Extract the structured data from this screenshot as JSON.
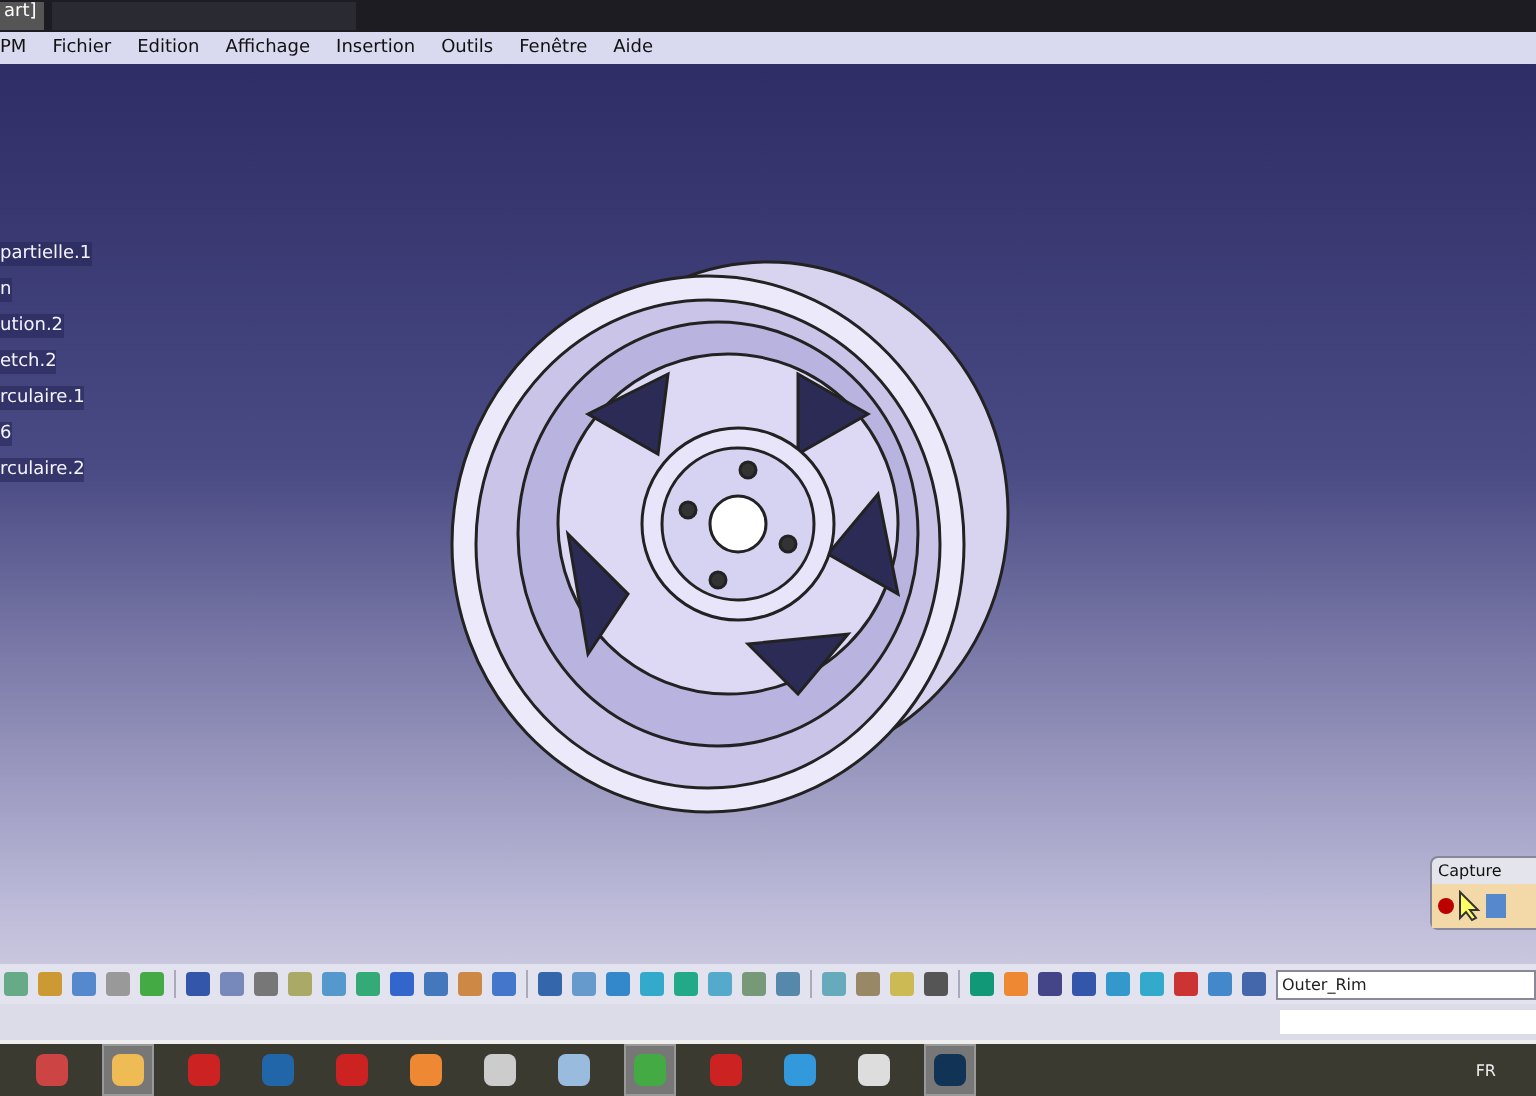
{
  "browser_tabs": [
    {
      "title": "art]",
      "selected": true
    },
    {
      "selected": false
    }
  ],
  "menu_bar": {
    "items": [
      "PM",
      "Fichier",
      "Edition",
      "Affichage",
      "Insertion",
      "Outils",
      "Fenêtre",
      "Aide"
    ]
  },
  "tree": {
    "items": [
      "partielle.1",
      "n",
      "ution.2",
      "etch.2",
      "rculaire.1",
      "6",
      "rculaire.2"
    ]
  },
  "capture_panel": {
    "title": "Capture"
  },
  "toolbar": {
    "combo_value": "Outer_Rim"
  },
  "taskbar": {
    "language": "FR"
  }
}
